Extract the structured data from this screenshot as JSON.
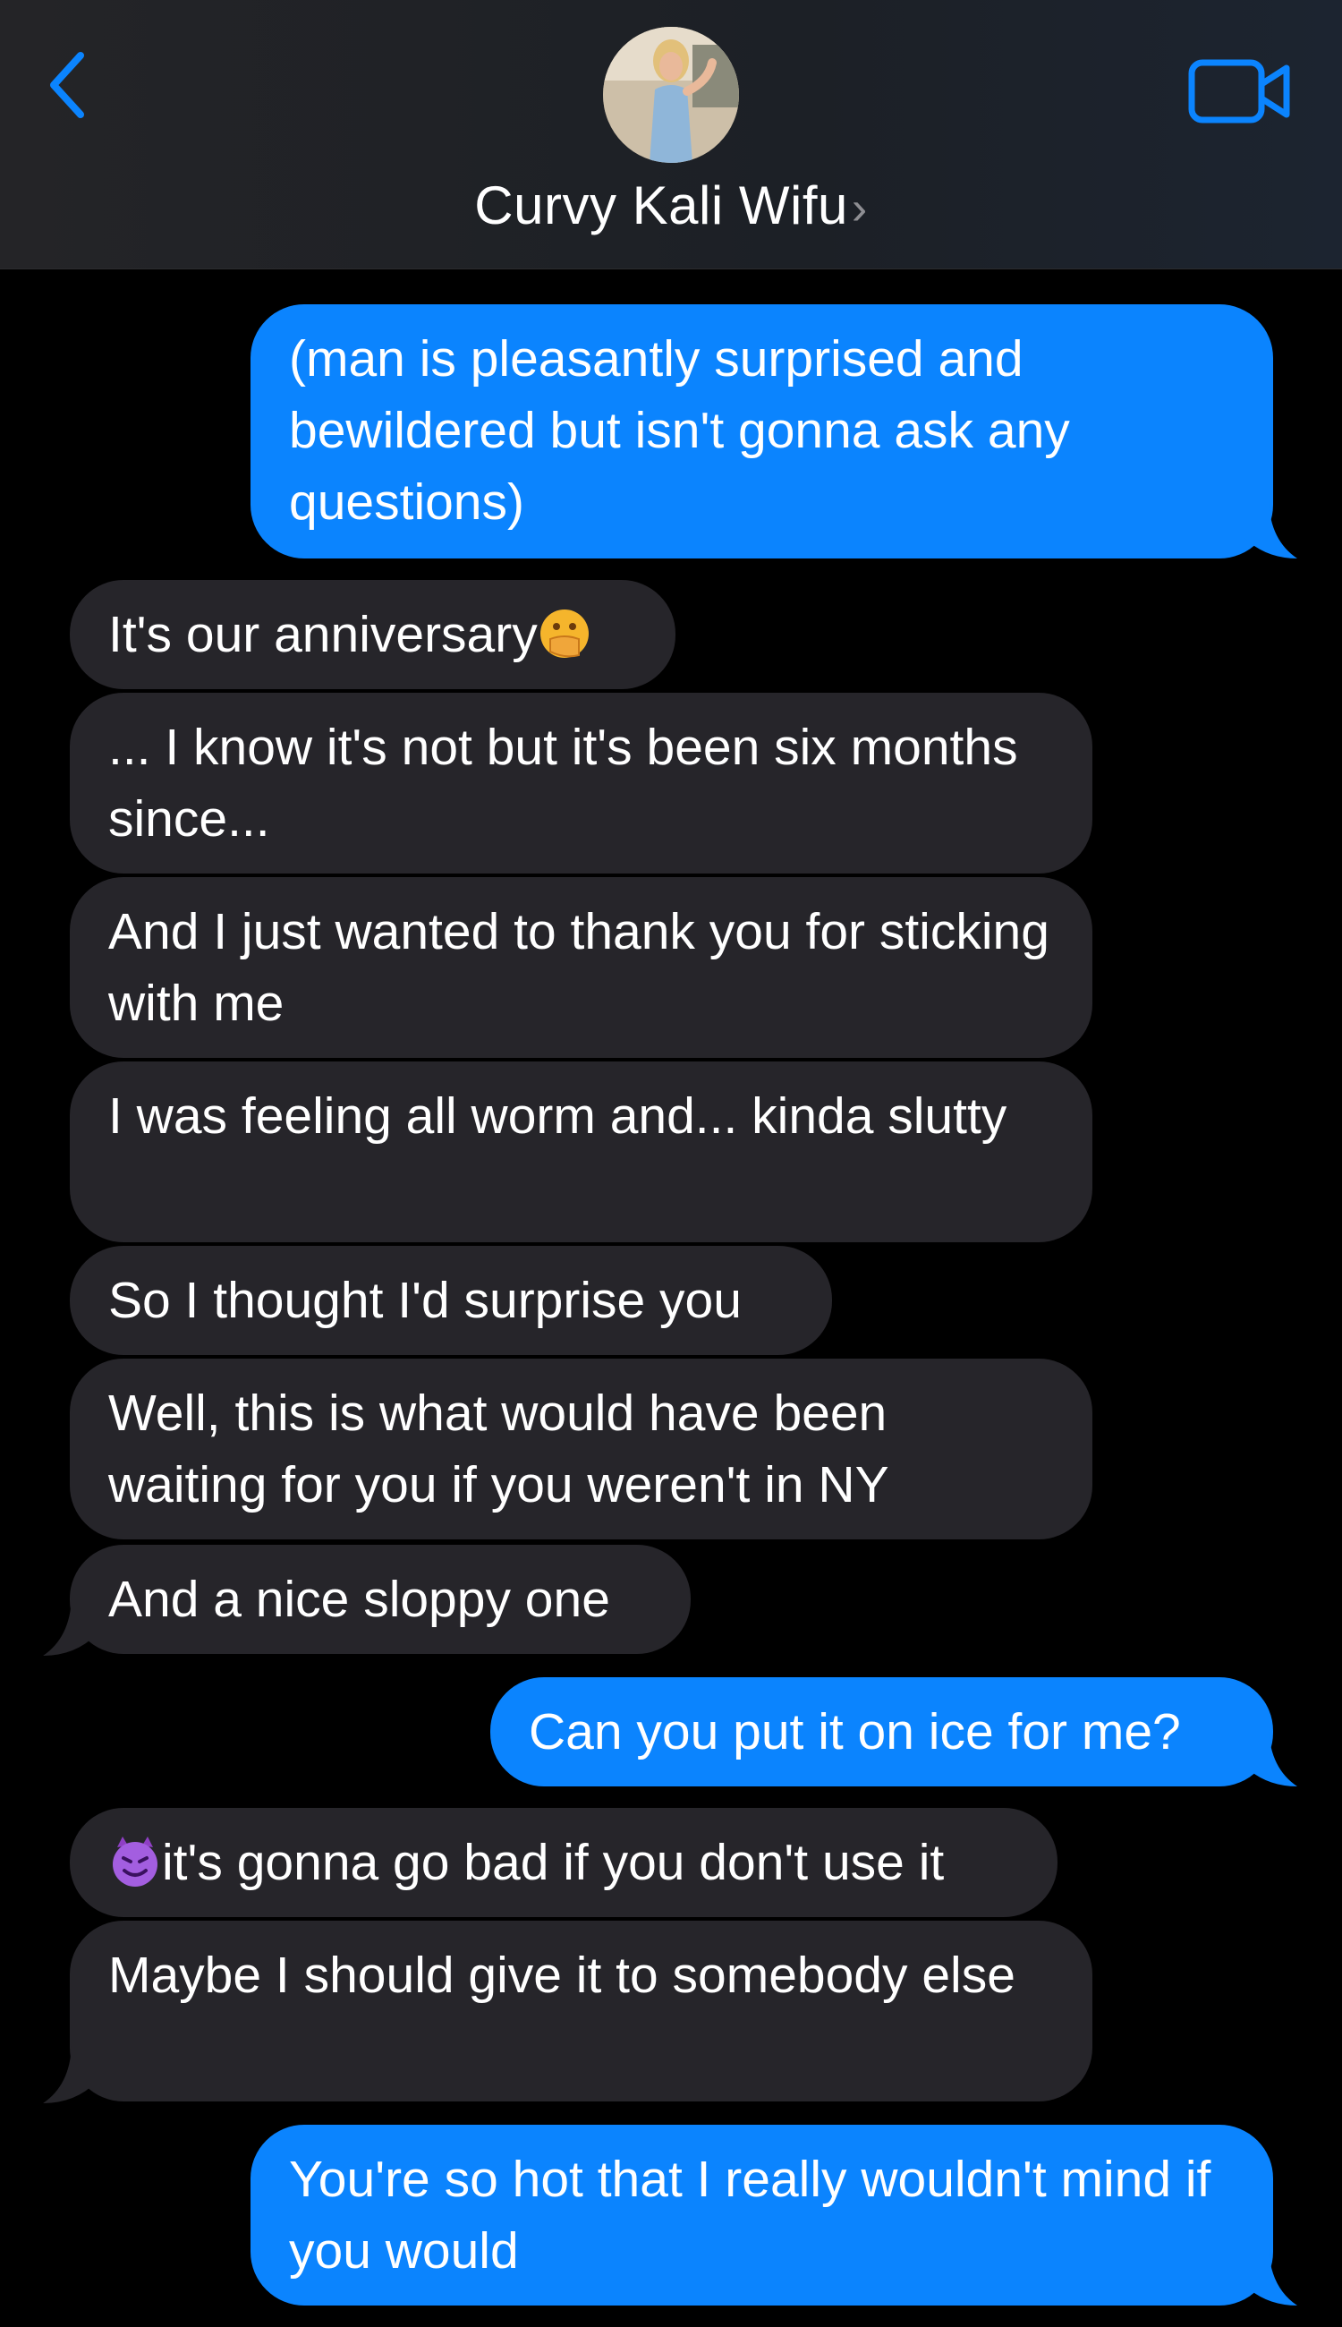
{
  "header": {
    "contact_name": "Curvy Kali Wifu",
    "chevron": "›",
    "back_icon": "chevron-left-icon",
    "video_icon": "video-camera-icon",
    "accent": "#0b84fe"
  },
  "colors": {
    "incoming_bubble": "#26252a",
    "outgoing_bubble": "#0b84fe",
    "background": "#000000"
  },
  "messages": [
    {
      "from": "me",
      "text": "(man is pleasantly surprised and bewildered but isn't gonna ask any questions)"
    },
    {
      "from": "them",
      "text": "It's our anniversary",
      "emoji_after": "hand-over-mouth-emoji"
    },
    {
      "from": "them",
      "text": "... I know it's not but it's been six months since..."
    },
    {
      "from": "them",
      "text": "And I just wanted to thank you for sticking with me"
    },
    {
      "from": "them",
      "text": "I was feeling all worm and... kinda slutty"
    },
    {
      "from": "them",
      "text": "So I thought I'd surprise you"
    },
    {
      "from": "them",
      "text": "Well, this is what would have been waiting for you if you weren't in NY"
    },
    {
      "from": "them",
      "text": "And a nice sloppy one"
    },
    {
      "from": "me",
      "text": "Can you put it on ice for me?"
    },
    {
      "from": "them",
      "text": "it's gonna go bad if you don't use it",
      "emoji_before": "smiling-devil-emoji"
    },
    {
      "from": "them",
      "text": "Maybe I should give it to somebody else"
    },
    {
      "from": "me",
      "text": "You're so hot that I really wouldn't mind if you would"
    }
  ]
}
